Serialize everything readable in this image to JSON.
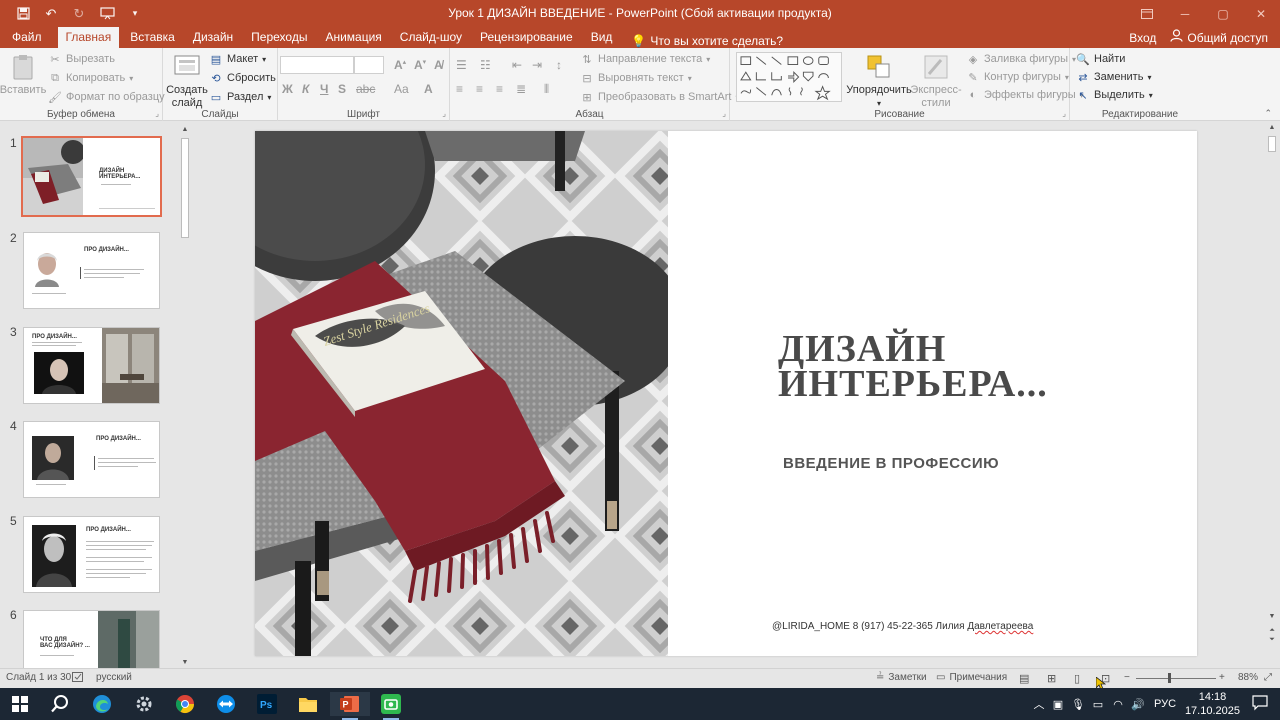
{
  "window": {
    "title": "Урок 1 ДИЗАЙН ВВЕДЕНИЕ - PowerPoint (Сбой активации продукта)"
  },
  "tabs": {
    "file": "Файл",
    "items": [
      "Главная",
      "Вставка",
      "Дизайн",
      "Переходы",
      "Анимация",
      "Слайд-шоу",
      "Рецензирование",
      "Вид"
    ],
    "tell_me": "Что вы хотите сделать?",
    "sign_in": "Вход",
    "share": "Общий доступ"
  },
  "ribbon": {
    "clipboard": {
      "label": "Буфер обмена",
      "paste": "Вставить",
      "cut": "Вырезать",
      "copy": "Копировать",
      "format_painter": "Формат по образцу"
    },
    "slides": {
      "label": "Слайды",
      "new_slide": "Создать\nслайд",
      "layout": "Макет",
      "reset": "Сбросить",
      "section": "Раздел"
    },
    "font": {
      "label": "Шрифт"
    },
    "paragraph": {
      "label": "Абзац",
      "text_direction": "Направление текста",
      "align_text": "Выровнять текст",
      "smartart": "Преобразовать в SmartArt"
    },
    "drawing": {
      "label": "Рисование",
      "arrange": "Упорядочить",
      "quick_styles": "Экспресс-\nстили",
      "shape_fill": "Заливка фигуры",
      "shape_outline": "Контур фигуры",
      "shape_effects": "Эффекты фигуры"
    },
    "editing": {
      "label": "Редактирование",
      "find": "Найти",
      "replace": "Заменить",
      "select": "Выделить"
    }
  },
  "thumbnails": [
    {
      "num": "1",
      "title": "ДИЗАЙН\nИНТЕРЬЕРА..."
    },
    {
      "num": "2",
      "title": "ПРО ДИЗАЙН..."
    },
    {
      "num": "3",
      "title": "ПРО ДИЗАЙН..."
    },
    {
      "num": "4",
      "title": "ПРО ДИЗАЙН..."
    },
    {
      "num": "5",
      "title": "ПРО ДИЗАЙН..."
    },
    {
      "num": "6",
      "title": "ЧТО ДЛЯ\nВАС ДИЗАЙН? ..."
    }
  ],
  "slide": {
    "title": "ДИЗАЙН\nИНТЕРЬЕРА...",
    "subtitle": "ВВЕДЕНИЕ  В ПРОФЕССИЮ",
    "contacts_prefix": "@LIRIDA_HOME 8 (917) 45-22-365 Лилия ",
    "contacts_name": "Давлетареева"
  },
  "status": {
    "slide_counter": "Слайд 1 из 30",
    "language": "русский",
    "notes": "Заметки",
    "comments": "Примечания",
    "zoom": "88%"
  },
  "taskbar": {
    "lang": "РУС",
    "time": "14:18",
    "date": "17.10.2025"
  },
  "colors": {
    "accent": "#b7472a",
    "selection": "#e26b4e",
    "taskbar": "#1c2734"
  }
}
